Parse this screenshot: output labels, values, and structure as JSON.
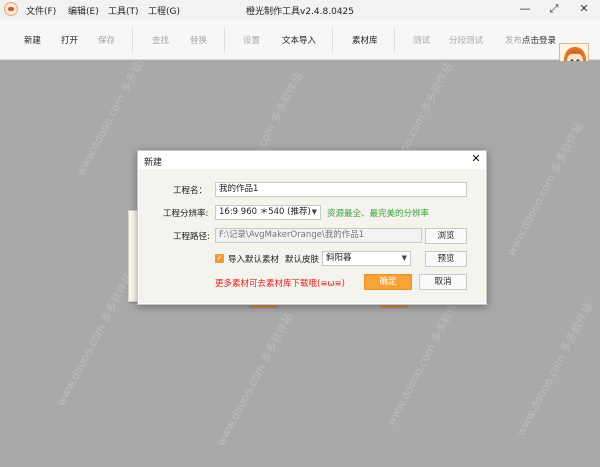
{
  "window": {
    "title": "橙光制作工具v2.4.8.0425",
    "menu": [
      "文件(F)",
      "编辑(E)",
      "工具(T)",
      "工程(G)"
    ],
    "controls": {
      "minimize": "—",
      "maximize": "⤢",
      "close": "✕"
    }
  },
  "toolbar": {
    "new": "新建",
    "open": "打开",
    "save": "保存",
    "find": "查找",
    "replace": "替换",
    "settings": "设置",
    "text_import": "文本导入",
    "assets": "素材库",
    "test": "测试",
    "segment_test": "分段测试",
    "publish": "发布",
    "login": "点击登录"
  },
  "watermark": "www.ddooo.com 多多软件站",
  "dialog": {
    "title": "新建",
    "close": "✕",
    "project_name_label": "工程名：",
    "project_name_value": "我的作品1",
    "resolution_label": "工程分辨率:",
    "resolution_value": "16:9  960 ＊540 (推荐)",
    "resolution_hint": "资源最全、最完美的分辨率",
    "path_label": "工程路径:",
    "path_value": "F:\\记录\\AvgMakerOrange\\我的作品1",
    "browse_button": "浏览",
    "import_default_assets_label": "导入默认素材",
    "import_default_assets_checked": true,
    "default_skin_label": "默认皮肤",
    "default_skin_value": "斜阳暮",
    "preview_button": "预览",
    "more_assets_note": "更多素材可去素材库下载哦(≡ω≡)",
    "ok_button": "确定",
    "cancel_button": "取消"
  },
  "colors": {
    "accent": "#f6a33a",
    "hint_green": "#3aa23a",
    "note_red": "#e02020",
    "workspace": "#a9a9a9"
  }
}
